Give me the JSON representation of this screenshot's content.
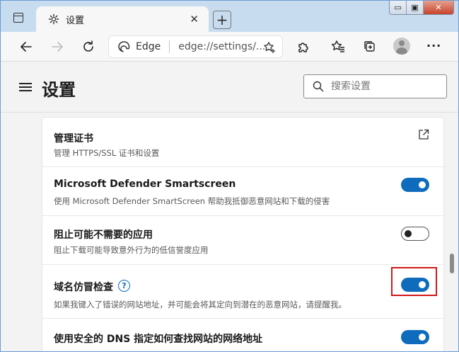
{
  "window": {
    "tab_title": "设置",
    "new_tab_symbol": "+",
    "minimize_symbol": "▭",
    "maximize_symbol": "▣",
    "close_symbol": "✕",
    "tab_close_symbol": "✕"
  },
  "toolbar": {
    "browser_label": "Edge",
    "url": "edge://settings/...",
    "more_symbol": "···"
  },
  "header": {
    "title": "设置",
    "search_placeholder": "搜索设置"
  },
  "settings": [
    {
      "title": "管理证书",
      "description": "管理 HTTPS/SSL 证书和设置",
      "control": "external-link"
    },
    {
      "title": "Microsoft Defender Smartscreen",
      "description": "使用 Microsoft Defender SmartScreen 帮助我抵御恶意网站和下载的侵害",
      "control": "toggle",
      "enabled": true
    },
    {
      "title": "阻止可能不需要的应用",
      "description": "阻止下载可能导致意外行为的低信誉度应用",
      "control": "toggle",
      "enabled": false
    },
    {
      "title": "域名仿冒检查",
      "description": "如果我键入了错误的网站地址，并可能会将其定向到潜在的恶意网站，请提醒我。",
      "control": "toggle",
      "enabled": true,
      "help": "?"
    },
    {
      "title": "使用安全的 DNS 指定如何查找网站的网络地址",
      "description": "",
      "control": "toggle",
      "enabled": true
    }
  ],
  "colors": {
    "accent": "#0f6cbd",
    "highlight": "#d01919",
    "titlebar": "#c8dcf0"
  },
  "icons": {
    "tab_actions": "tab-actions-icon",
    "tab": "gear-icon",
    "back": "back-arrow-icon",
    "forward": "forward-arrow-icon",
    "refresh": "refresh-icon",
    "browser": "edge-logo-icon",
    "favorite_add": "star-add-icon",
    "extensions": "puzzle-icon",
    "favorites": "favorites-icon",
    "collections": "collections-icon",
    "profile": "avatar-icon",
    "menu": "hamburger-icon",
    "search": "search-icon",
    "external_link": "external-link-icon",
    "help": "help-icon"
  }
}
